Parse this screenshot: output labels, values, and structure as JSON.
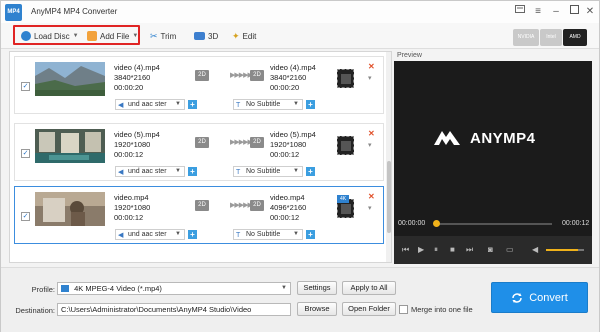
{
  "window": {
    "title": "AnyMP4 MP4 Converter",
    "logo_text": "MP4"
  },
  "toolbar": {
    "load_disc": "Load Disc",
    "add_file": "Add File",
    "trim": "Trim",
    "three_d": "3D",
    "edit": "Edit",
    "accel": [
      "NVIDIA",
      "Intel",
      "AMD"
    ]
  },
  "files": [
    {
      "src_name": "video (4).mp4",
      "src_res": "3840*2160",
      "src_dur": "00:00:20",
      "out_name": "video (4).mp4",
      "out_res": "3840*2160",
      "out_dur": "00:00:20",
      "audio": "und aac ster",
      "subtitle": "No Subtitle",
      "badge": "2D",
      "selected": false
    },
    {
      "src_name": "video (5).mp4",
      "src_res": "1920*1080",
      "src_dur": "00:00:12",
      "out_name": "video (5).mp4",
      "out_res": "1920*1080",
      "out_dur": "00:00:12",
      "audio": "und aac ster",
      "subtitle": "No Subtitle",
      "badge": "2D",
      "selected": false
    },
    {
      "src_name": "video.mp4",
      "src_res": "1920*1080",
      "src_dur": "00:00:12",
      "out_name": "video.mp4",
      "out_res": "4096*2160",
      "out_dur": "00:00:12",
      "audio": "und aac ster",
      "subtitle": "No Subtitle",
      "badge": "2D",
      "format_tag": "4K",
      "selected": true
    }
  ],
  "preview": {
    "header": "Preview",
    "brand": "ANYMP4",
    "time_start": "00:00:00",
    "time_end": "00:00:12",
    "progress": 0.02,
    "volume": 0.85
  },
  "bottom": {
    "profile_label": "Profile:",
    "profile_value": "4K MPEG-4 Video (*.mp4)",
    "settings": "Settings",
    "apply_all": "Apply to All",
    "destination_label": "Destination:",
    "destination_value": "C:\\Users\\Administrator\\Documents\\AnyMP4 Studio\\Video",
    "browse": "Browse",
    "open_folder": "Open Folder",
    "merge_label": "Merge into one file",
    "convert": "Convert"
  },
  "colors": {
    "accent": "#1f8fe8",
    "highlight": "#e02424",
    "progress": "#f0b21a"
  }
}
